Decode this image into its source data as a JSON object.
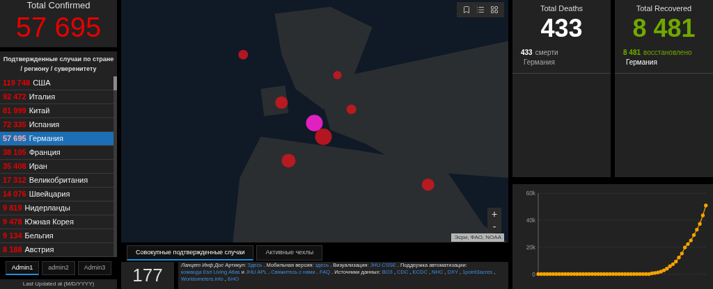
{
  "confirmed": {
    "title": "Total Confirmed",
    "value": "57 695"
  },
  "country_list": {
    "heading": "Подтвержденные случаи по стране / региону / суверенитету",
    "rows": [
      {
        "count": "119 748",
        "name": "США",
        "selected": false
      },
      {
        "count": "92 472",
        "name": "Италия",
        "selected": false
      },
      {
        "count": "81 999",
        "name": "Китай",
        "selected": false
      },
      {
        "count": "72 335",
        "name": "Испания",
        "selected": false
      },
      {
        "count": "57 695",
        "name": "Германия",
        "selected": true
      },
      {
        "count": "38 105",
        "name": "Франция",
        "selected": false
      },
      {
        "count": "35 408",
        "name": "Иран",
        "selected": false
      },
      {
        "count": "17 312",
        "name": "Великобритания",
        "selected": false
      },
      {
        "count": "14 076",
        "name": "Швейцария",
        "selected": false
      },
      {
        "count": "9 819",
        "name": "Нидерланды",
        "selected": false
      },
      {
        "count": "9 478",
        "name": "Южная Корея",
        "selected": false
      },
      {
        "count": "9 134",
        "name": "Бельгия",
        "selected": false
      },
      {
        "count": "8 188",
        "name": "Австрия",
        "selected": false
      }
    ]
  },
  "admin_tabs": [
    {
      "label": "Admin1",
      "selected": true
    },
    {
      "label": "admin2",
      "selected": false
    },
    {
      "label": "Admin3",
      "selected": false
    }
  ],
  "last_updated": "Last Updated at (M/D/YYYY)",
  "map": {
    "kind": "picture",
    "attribution": "Эсри, ФАО, NOAA",
    "zoom_in": "+",
    "zoom_out": "-"
  },
  "map_tabs": [
    {
      "label": "Совокупные подтвержденные случаи",
      "selected": true
    },
    {
      "label": "Активные чехлы",
      "selected": false
    }
  ],
  "countries_count": "177",
  "info": [
    {
      "kind": "italic",
      "text": "Ланцет Инф Дис"
    },
    {
      "kind": "text",
      "text": " Артикул: "
    },
    {
      "kind": "link",
      "text": "Здесь"
    },
    {
      "kind": "text",
      "text": " . Мобильная версия: "
    },
    {
      "kind": "link",
      "text": "здесь"
    },
    {
      "kind": "text",
      "text": " . Визуализация: "
    },
    {
      "kind": "link",
      "text": "JHU CSSE"
    },
    {
      "kind": "text",
      "text": " . Поддержка автоматизации: "
    },
    {
      "kind": "link",
      "text": "команда Esri Living Atlas"
    },
    {
      "kind": "text",
      "text": " и "
    },
    {
      "kind": "link",
      "text": "JHU APL"
    },
    {
      "kind": "text",
      "text": " . "
    },
    {
      "kind": "link",
      "text": "Свяжитесь с нами"
    },
    {
      "kind": "text",
      "text": " . "
    },
    {
      "kind": "link",
      "text": "FAQ"
    },
    {
      "kind": "text",
      "text": " . Источники данных: "
    },
    {
      "kind": "link",
      "text": "ВОЗ"
    },
    {
      "kind": "text",
      "text": " , "
    },
    {
      "kind": "link",
      "text": "CDC"
    },
    {
      "kind": "text",
      "text": " , "
    },
    {
      "kind": "link",
      "text": "ECDC"
    },
    {
      "kind": "text",
      "text": " , "
    },
    {
      "kind": "link",
      "text": "NHC"
    },
    {
      "kind": "text",
      "text": " , "
    },
    {
      "kind": "link",
      "text": "DXY"
    },
    {
      "kind": "text",
      "text": " , "
    },
    {
      "kind": "link",
      "text": "1point3acres"
    },
    {
      "kind": "text",
      "text": " , "
    },
    {
      "kind": "link",
      "text": "Worldometers.info"
    },
    {
      "kind": "text",
      "text": " , "
    },
    {
      "kind": "link",
      "text": "БНО"
    }
  ],
  "deaths": {
    "title": "Total Deaths",
    "value": "433",
    "count": "433",
    "label": "смерти",
    "country": "Германия"
  },
  "recovered": {
    "title": "Total Recovered",
    "value": "8 481",
    "count": "8 481",
    "label": "восстановлено",
    "country": "Германия"
  },
  "chart": {
    "chart_data": {
      "type": "line",
      "ylim": [
        0,
        60000
      ],
      "yticks": [
        {
          "value": 0,
          "label": "0"
        },
        {
          "value": 20000,
          "label": "20k"
        },
        {
          "value": 40000,
          "label": "40k"
        },
        {
          "value": 60000,
          "label": "60k"
        }
      ],
      "values": [
        0,
        0,
        0,
        0,
        0,
        0,
        0,
        0,
        0,
        0,
        0,
        0,
        0,
        0,
        0,
        0,
        0,
        0,
        0,
        0,
        0,
        0,
        0,
        0,
        0,
        0,
        0,
        0,
        0,
        0,
        0,
        0,
        0,
        0,
        0,
        0,
        0,
        0,
        500,
        800,
        1200,
        1800,
        2800,
        4000,
        5800,
        7300,
        9300,
        12300,
        15300,
        19800,
        22300,
        25000,
        29000,
        33000,
        37300,
        43600,
        51000
      ]
    }
  }
}
